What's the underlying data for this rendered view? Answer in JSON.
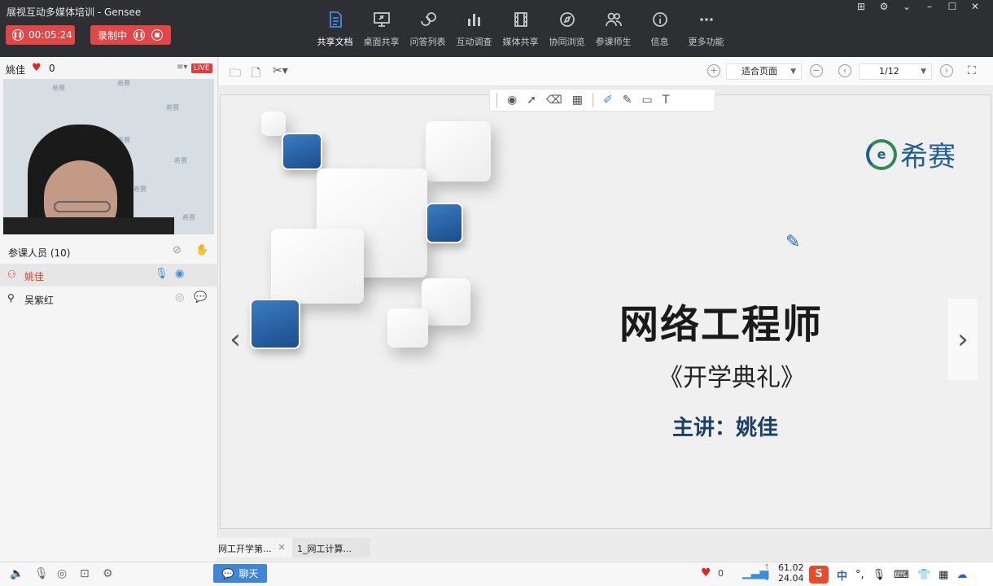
{
  "app": {
    "title": "展视互动多媒体培训 - Gensee"
  },
  "recording": {
    "timer": "00:05:24",
    "status_label": "录制中"
  },
  "toolbar": {
    "items": [
      {
        "label": "共享文档",
        "icon": "document-share-icon",
        "active": true
      },
      {
        "label": "桌面共享",
        "icon": "desktop-share-icon"
      },
      {
        "label": "问答列表",
        "icon": "qa-list-icon"
      },
      {
        "label": "互动调查",
        "icon": "survey-chart-icon"
      },
      {
        "label": "媒体共享",
        "icon": "media-film-icon"
      },
      {
        "label": "协同浏览",
        "icon": "compass-icon"
      },
      {
        "label": "参课师生",
        "icon": "users-icon"
      },
      {
        "label": "信息",
        "icon": "info-icon"
      },
      {
        "label": "更多功能",
        "icon": "more-dots-icon"
      }
    ]
  },
  "host": {
    "name": "姚佳",
    "likes": "0",
    "live_badge": "LIVE"
  },
  "video": {
    "watermark": "希赛"
  },
  "participants": {
    "header": "参课人员 (10)",
    "users": [
      {
        "name": "姚佳",
        "active": true
      },
      {
        "name": "吴紫红",
        "active": false
      }
    ]
  },
  "docbar": {
    "zoom": "适合页面",
    "page": "1/12"
  },
  "slide": {
    "logo": "希赛",
    "title": "网络工程师",
    "subtitle": "《开学典礼》",
    "presenter": "主讲：姚佳"
  },
  "doc_tabs": [
    {
      "label": "网工开学第..."
    },
    {
      "label": "1_网工计算..."
    }
  ],
  "bottom": {
    "chat_label": "聊天",
    "likes": "0",
    "upload": "61.02 k",
    "download": "24.04 k",
    "ime_lang": "中"
  },
  "colors": {
    "accent": "#3d8de8",
    "record": "#e34646",
    "brand_blue": "#1f5e9a"
  }
}
